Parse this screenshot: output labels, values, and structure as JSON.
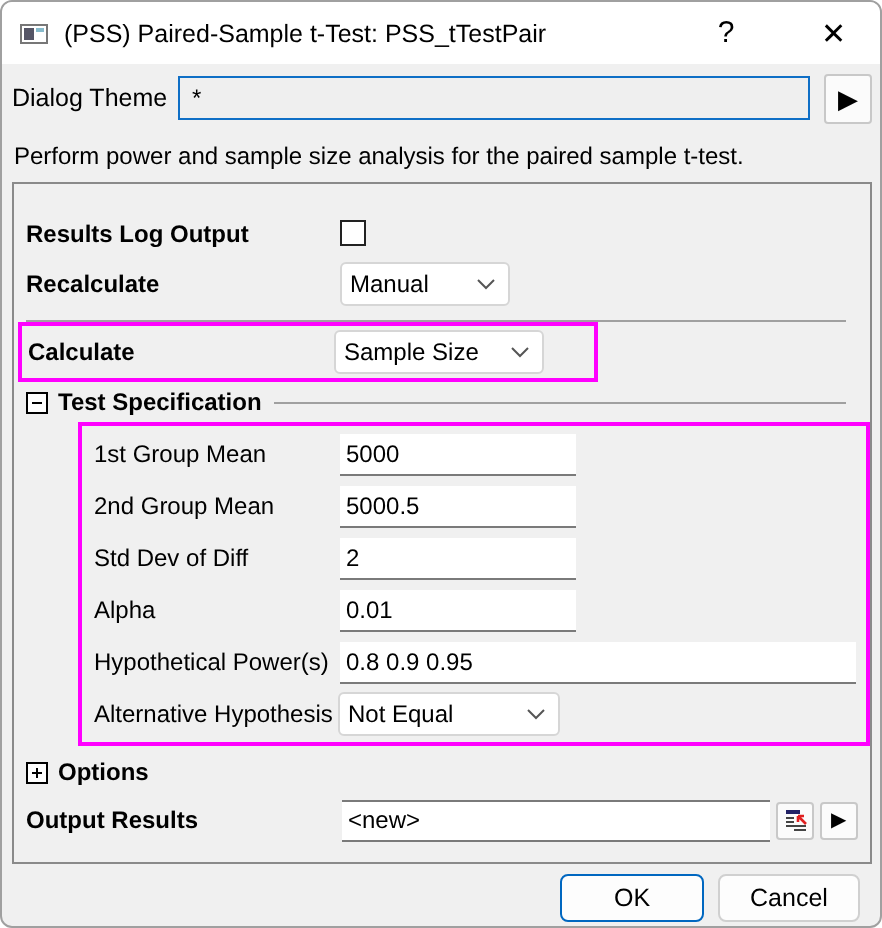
{
  "window": {
    "title": "(PSS) Paired-Sample t-Test: PSS_tTestPair",
    "help": "?",
    "close": "✕"
  },
  "theme": {
    "label": "Dialog Theme",
    "value": "*",
    "arrow": "▶"
  },
  "description": "Perform power and sample size analysis for the paired sample t-test.",
  "settings": [
    {
      "kind": "checkbox",
      "label": "Results Log Output",
      "checked": false
    },
    {
      "kind": "dropdown",
      "label": "Recalculate",
      "value": "Manual"
    }
  ],
  "calculate": {
    "label": "Calculate",
    "value": "Sample Size",
    "highlighted": true
  },
  "test_specification": {
    "title": "Test Specification",
    "expanded": true,
    "highlighted": true,
    "fields": [
      {
        "kind": "text",
        "label": "1st Group Mean",
        "value": "5000"
      },
      {
        "kind": "text",
        "label": "2nd Group Mean",
        "value": "5000.5"
      },
      {
        "kind": "text",
        "label": "Std Dev of Diff",
        "value": "2"
      },
      {
        "kind": "text",
        "label": "Alpha",
        "value": "0.01"
      },
      {
        "kind": "wide",
        "label": "Hypothetical Power(s)",
        "value": "0.8 0.9 0.95"
      },
      {
        "kind": "dropdown",
        "label": "Alternative Hypothesis",
        "value": "Not Equal"
      }
    ]
  },
  "options": {
    "title": "Options",
    "expanded": false
  },
  "output": {
    "label": "Output Results",
    "value": "<new>",
    "arrow": "▶"
  },
  "buttons": [
    {
      "label": "OK",
      "default": true
    },
    {
      "label": "Cancel",
      "default": false
    }
  ]
}
